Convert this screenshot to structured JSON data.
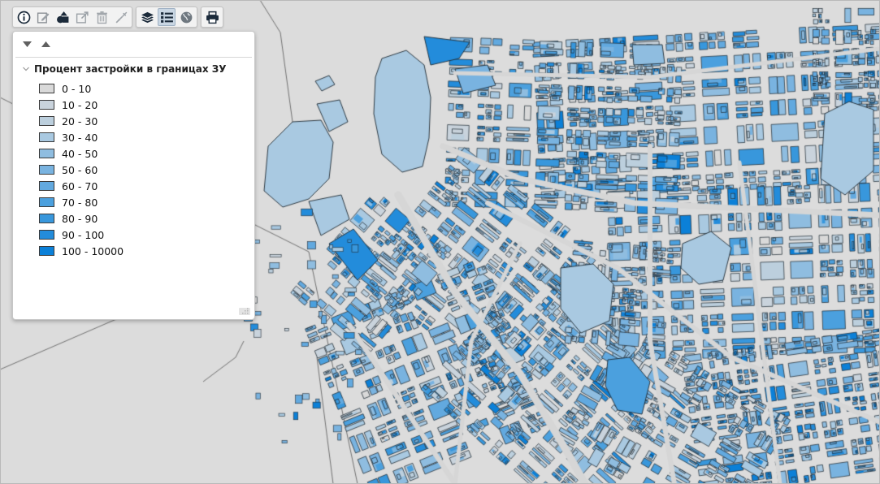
{
  "toolbar": {
    "groups": [
      [
        "info-icon",
        "edit-icon",
        "shapes-icon",
        "export-icon",
        "delete-icon",
        "measure-icon"
      ],
      [
        "layers-icon",
        "legend-icon",
        "globe-icon"
      ],
      [
        "print-icon"
      ]
    ],
    "active": "legend-icon"
  },
  "legend": {
    "title": "Процент застройки в границах ЗУ",
    "items": [
      {
        "label": "0 - 10",
        "color": "#d9d9d9"
      },
      {
        "label": "10 - 20",
        "color": "#c9d3dc"
      },
      {
        "label": "20 - 30",
        "color": "#bccfdd"
      },
      {
        "label": "30 - 40",
        "color": "#a9c9e1"
      },
      {
        "label": "40 - 50",
        "color": "#8fbde0"
      },
      {
        "label": "50 - 60",
        "color": "#79b3e0"
      },
      {
        "label": "60 - 70",
        "color": "#62a9df"
      },
      {
        "label": "70 - 80",
        "color": "#4ba0de"
      },
      {
        "label": "80 - 90",
        "color": "#3897dc"
      },
      {
        "label": "90 - 100",
        "color": "#238cdb"
      },
      {
        "label": "100 - 10000",
        "color": "#0b80d8"
      }
    ]
  },
  "map": {
    "background": "#dcdcdc",
    "street_color": "#d6d6d6",
    "outline_color": "#1e2a33"
  }
}
